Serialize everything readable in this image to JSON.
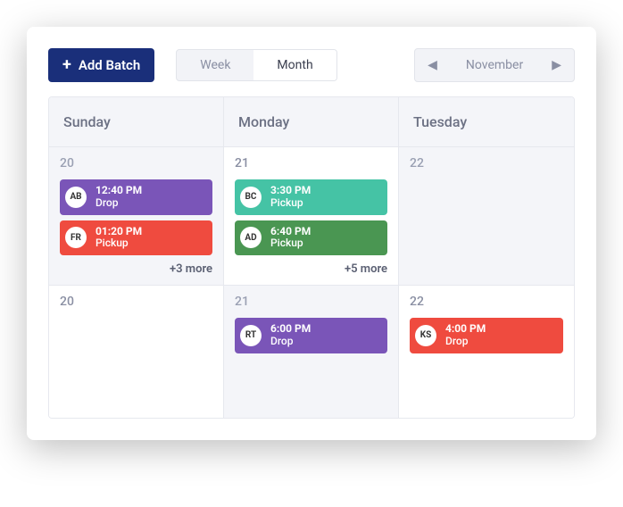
{
  "toolbar": {
    "add_label": "Add Batch",
    "view_week": "Week",
    "view_month": "Month",
    "month_label": "November"
  },
  "headers": [
    "Sunday",
    "Monday",
    "Tuesday"
  ],
  "rows": [
    {
      "cells": [
        {
          "day": "20",
          "inactive": true,
          "events": [
            {
              "initials": "AB",
              "time": "12:40 PM",
              "type": "Drop",
              "color": "purple"
            },
            {
              "initials": "FR",
              "time": "01:20 PM",
              "type": "Pickup",
              "color": "red"
            }
          ],
          "more": "+3 more"
        },
        {
          "day": "21",
          "inactive": false,
          "events": [
            {
              "initials": "BC",
              "time": "3:30 PM",
              "type": "Pickup",
              "color": "teal"
            },
            {
              "initials": "AD",
              "time": "6:40 PM",
              "type": "Pickup",
              "color": "green"
            }
          ],
          "more": "+5 more"
        },
        {
          "day": "22",
          "inactive": true,
          "events": [],
          "more": null
        }
      ]
    },
    {
      "cells": [
        {
          "day": "20",
          "inactive": false,
          "events": [],
          "more": null
        },
        {
          "day": "21",
          "inactive": true,
          "events": [
            {
              "initials": "RT",
              "time": "6:00 PM",
              "type": "Drop",
              "color": "purple"
            }
          ],
          "more": null
        },
        {
          "day": "22",
          "inactive": false,
          "events": [
            {
              "initials": "KS",
              "time": "4:00 PM",
              "type": "Drop",
              "color": "red"
            }
          ],
          "more": null
        }
      ]
    }
  ]
}
